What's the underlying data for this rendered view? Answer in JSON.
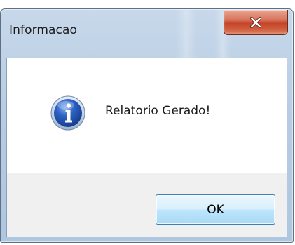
{
  "window": {
    "title": "Informacao",
    "close_icon": "close-x-icon"
  },
  "dialog": {
    "icon": "information-icon",
    "message": "Relatorio Gerado!",
    "ok_label": "OK"
  },
  "colors": {
    "frame": "#b7cce3",
    "close_button": "#c4462a",
    "info_icon": "#2a5bb7",
    "ok_button_border": "#3c7fb1",
    "button_area": "#f0f0f0"
  }
}
